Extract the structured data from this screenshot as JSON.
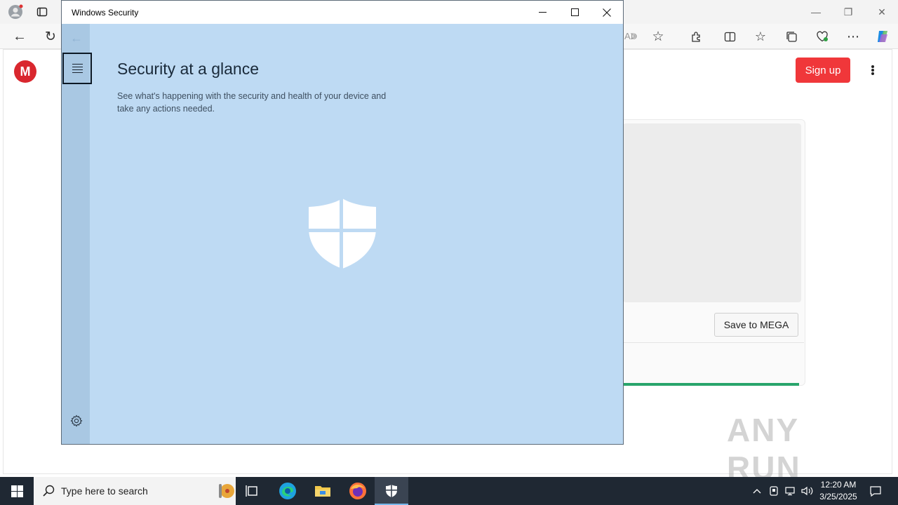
{
  "browser": {
    "toolbar_icons": [
      "back-icon",
      "refresh-icon",
      "read-aloud-icon",
      "favorite-star-icon",
      "extensions-icon",
      "split-screen-icon",
      "favorites-icon",
      "collections-icon",
      "browser-essentials-icon",
      "more-icon",
      "copilot-icon"
    ]
  },
  "mega": {
    "logo_letter": "M",
    "signup_label": "Sign up",
    "save_label": "Save to MEGA",
    "progress_fraction": 1.0,
    "accent_color": "#f0373a",
    "progress_color": "#28a46b"
  },
  "watermark": {
    "text": "ANY RUN"
  },
  "windows_security": {
    "title": "Windows Security",
    "heading": "Security at a glance",
    "description": "See what's happening with the security and health of your device and take any actions needed.",
    "background_color": "#bedaf3"
  },
  "taskbar": {
    "search_placeholder": "Type here to search",
    "clock_time": "12:20 AM",
    "clock_date": "3/25/2025",
    "pinned": [
      "task-view-icon",
      "edge-icon",
      "file-explorer-icon",
      "firefox-icon",
      "windows-security-icon"
    ]
  }
}
